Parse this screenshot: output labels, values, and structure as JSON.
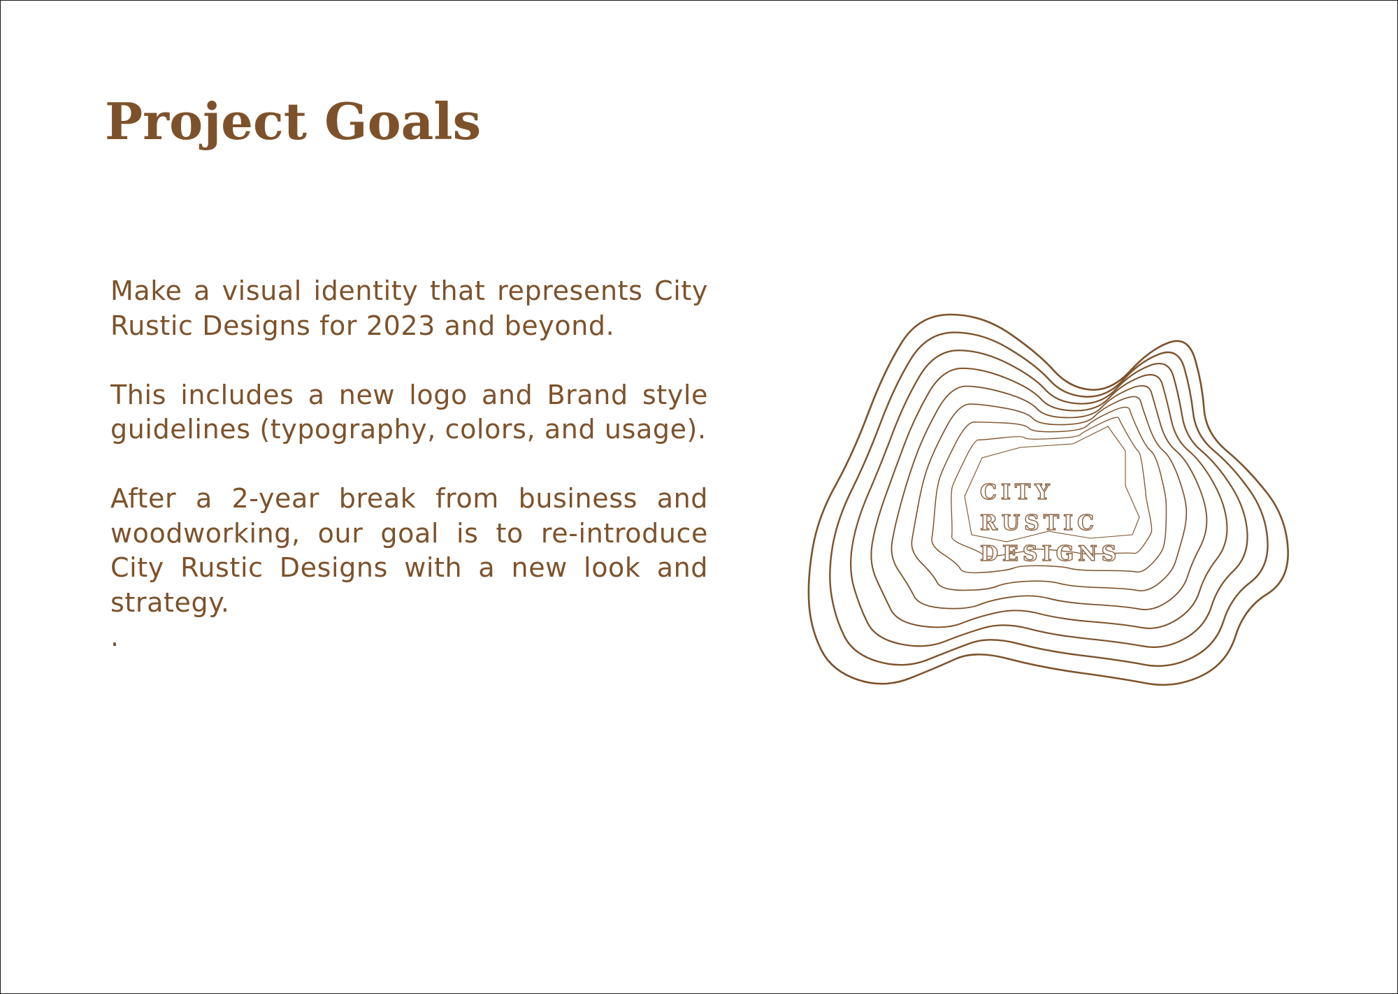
{
  "title": "Project Goals",
  "paragraphs": [
    "Make a visual identity that represents City Rustic Designs for 2023 and beyond.",
    "This includes a new logo and Brand style guidelines (typography, colors, and usage).",
    "After a 2-year break from business and woodworking, our goal is to re-introduce City Rustic Designs with a new look and strategy."
  ],
  "trailing_mark": ".",
  "logo": {
    "line1": "CITY",
    "line2": "RUSTIC",
    "line3": "DESIGNS"
  },
  "colors": {
    "brand_brown": "#7d522b",
    "background": "#ffffff",
    "frame": "#1a1a1a"
  }
}
